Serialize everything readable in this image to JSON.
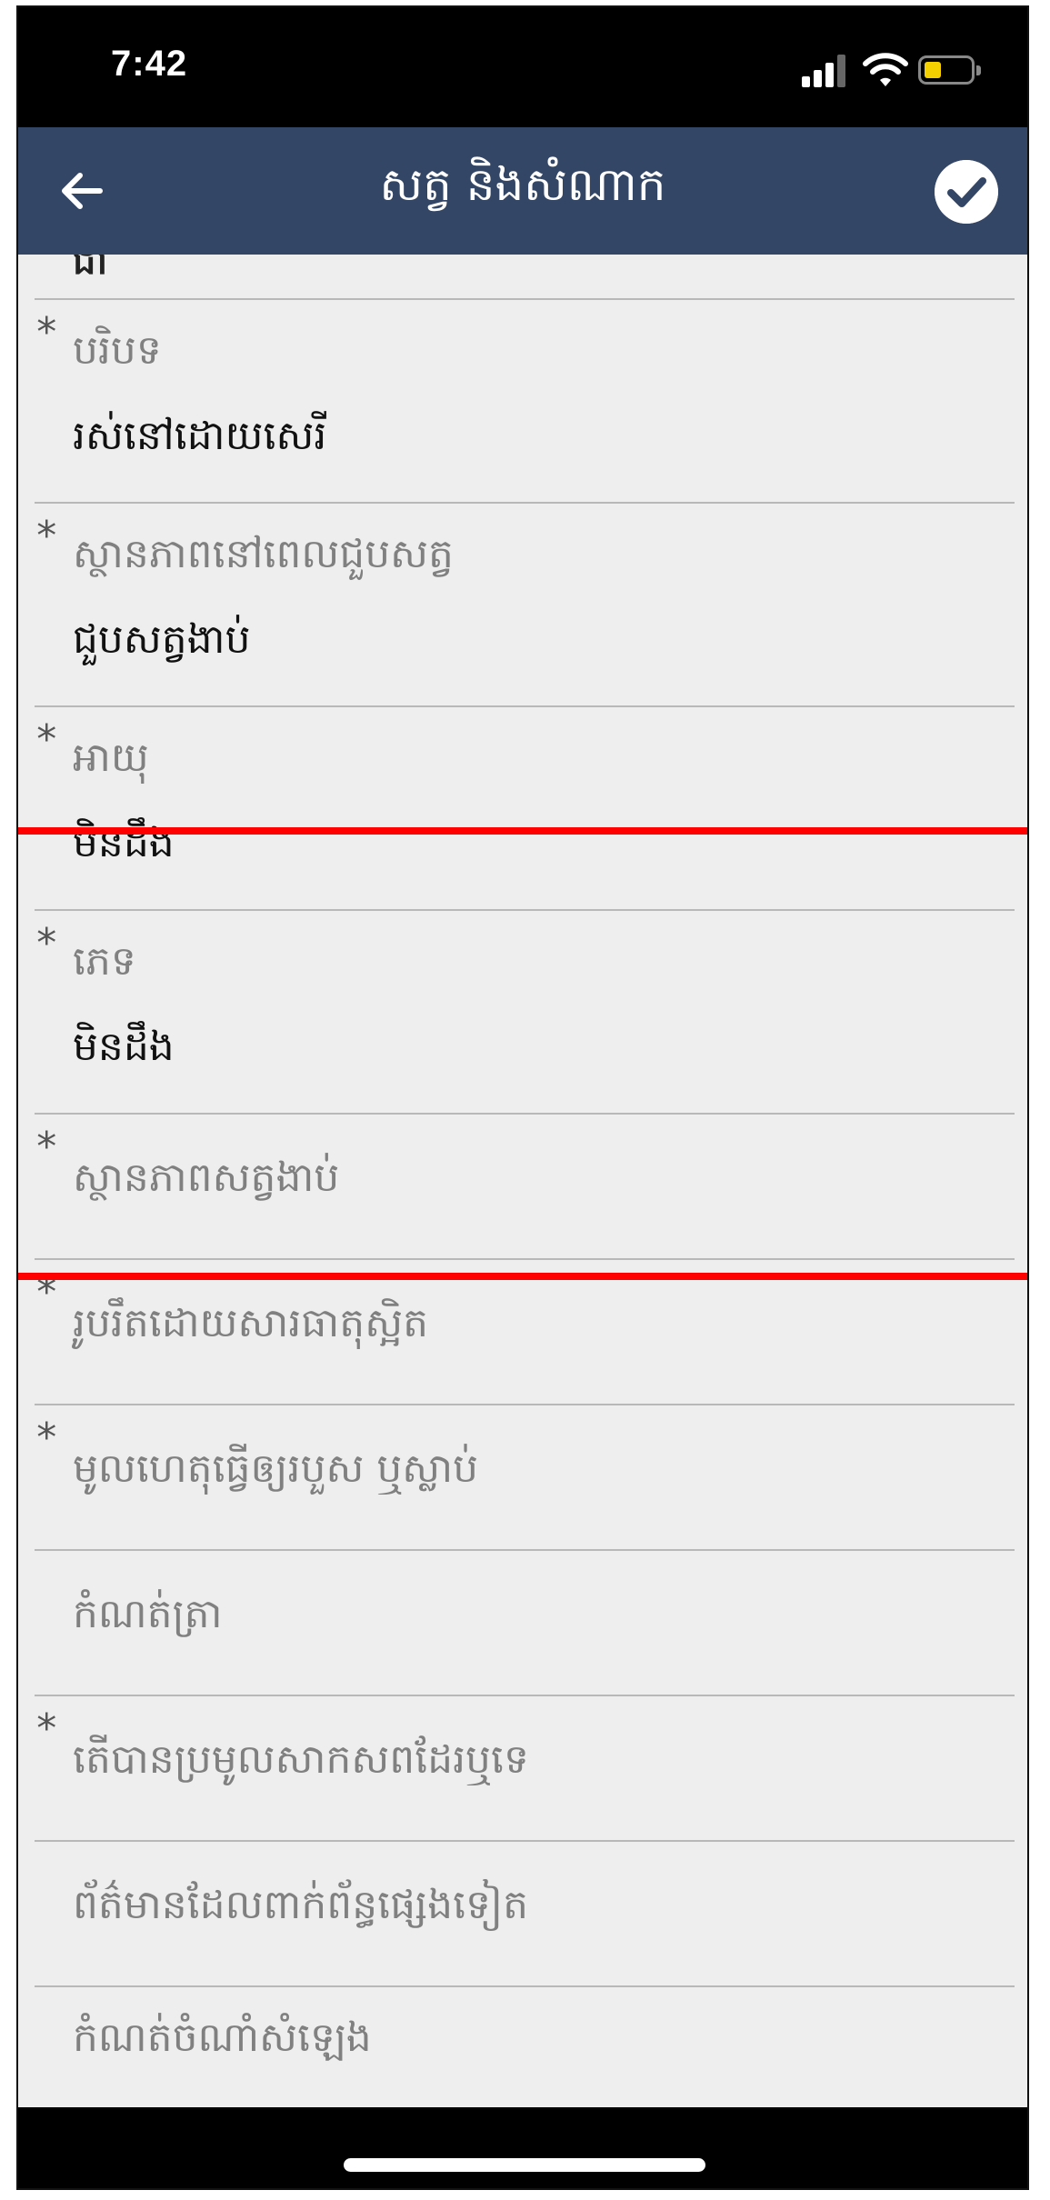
{
  "status_bar": {
    "time": "7:42"
  },
  "app_bar": {
    "title": "សត្វ និងសំណាក"
  },
  "form": {
    "partial_top_value": "ជា",
    "fields": [
      {
        "required": "*",
        "label": "បរិបទ",
        "value": "រស់នៅដោយសេរី"
      },
      {
        "required": "*",
        "label": "ស្ថានភាពនៅពេលជួបសត្វ",
        "value": "ជួបសត្វងាប់"
      },
      {
        "required": "*",
        "label": "អាយុ",
        "value": "មិនដឹង"
      },
      {
        "required": "*",
        "label": "ភេទ",
        "value": "មិនដឹង"
      },
      {
        "required": "*",
        "label": "ស្ថានភាពសត្វងាប់"
      },
      {
        "required": "*",
        "label": "រូបរឹតដោយសារធាតុស្អិត"
      },
      {
        "required": "*",
        "label": "មូលហេតុធ្វើឲ្យរបួស ឬស្លាប់"
      },
      {
        "label": "កំណត់ត្រា"
      },
      {
        "required": "*",
        "label": "តើបានប្រមូលសាកសពដែរឬទេ"
      },
      {
        "label": "ព័ត៌មានដែលពាក់ព័ន្ធផ្សេងទៀត"
      },
      {
        "label": "កំណត់ចំណាំសំឡេង"
      }
    ]
  },
  "icons": {
    "back": "arrow-left-icon",
    "confirm": "check-circle-icon",
    "signal": "cellular-signal-icon",
    "wifi": "wifi-icon",
    "battery": "battery-low-icon"
  },
  "colors": {
    "app_bar": "#344666",
    "content_background": "#eeeeee",
    "highlight_border": "#ff0000",
    "battery_level": "#f4d000"
  }
}
